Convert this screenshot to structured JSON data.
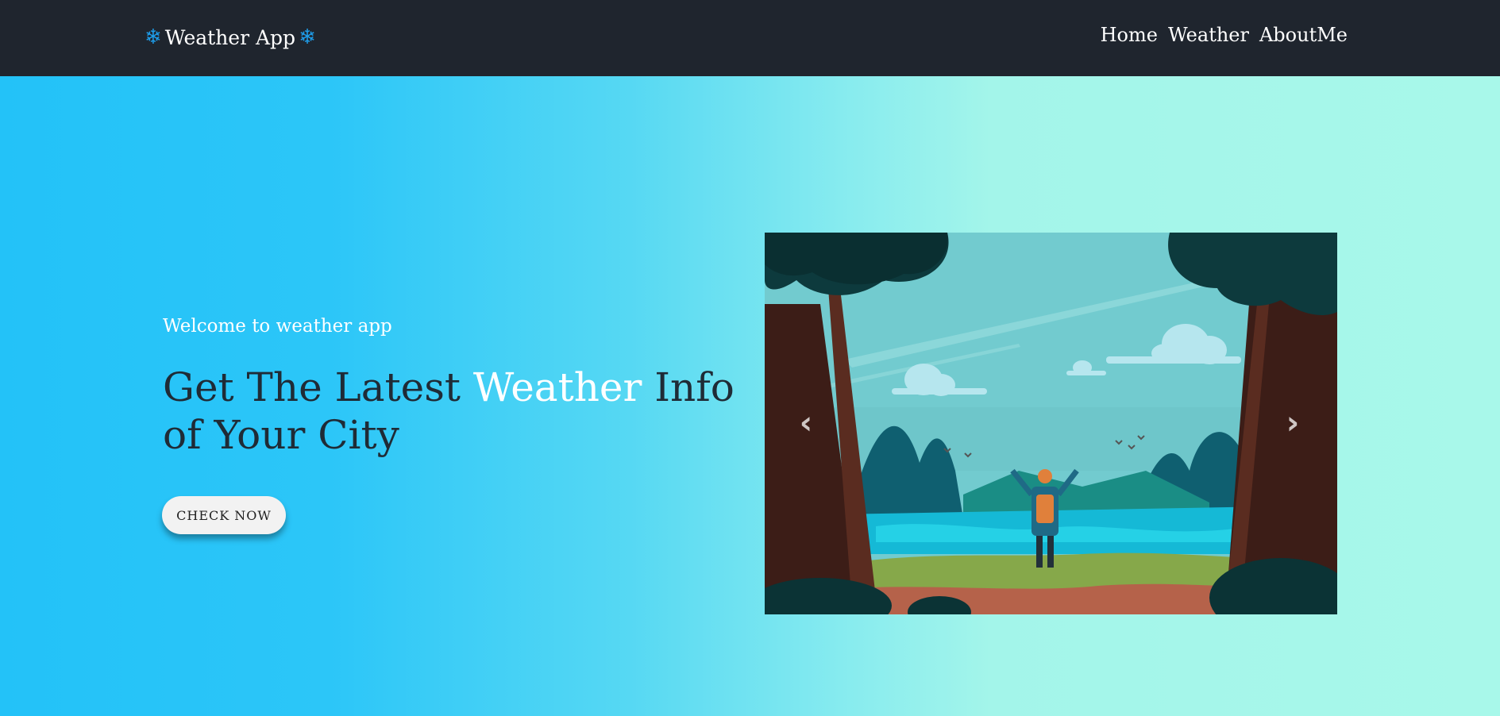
{
  "navbar": {
    "brand": "Weather App",
    "brand_icon": "snowflake-icon",
    "links": [
      "Home",
      "Weather",
      "AboutMe"
    ]
  },
  "hero": {
    "welcome": "Welcome to weather app",
    "headline_before": "Get The Latest ",
    "headline_highlight": "Weather",
    "headline_after": " Info of Your City",
    "cta_label": "CHECK NOW"
  },
  "carousel": {
    "prev_icon": "chevron-left-icon",
    "next_icon": "chevron-right-icon"
  },
  "colors": {
    "navbar_bg": "#1f252e",
    "gradient_start": "#23c2f8",
    "gradient_end": "#a8f8ea",
    "highlight": "#ffffff",
    "snowflake": "#1e9ce8"
  }
}
